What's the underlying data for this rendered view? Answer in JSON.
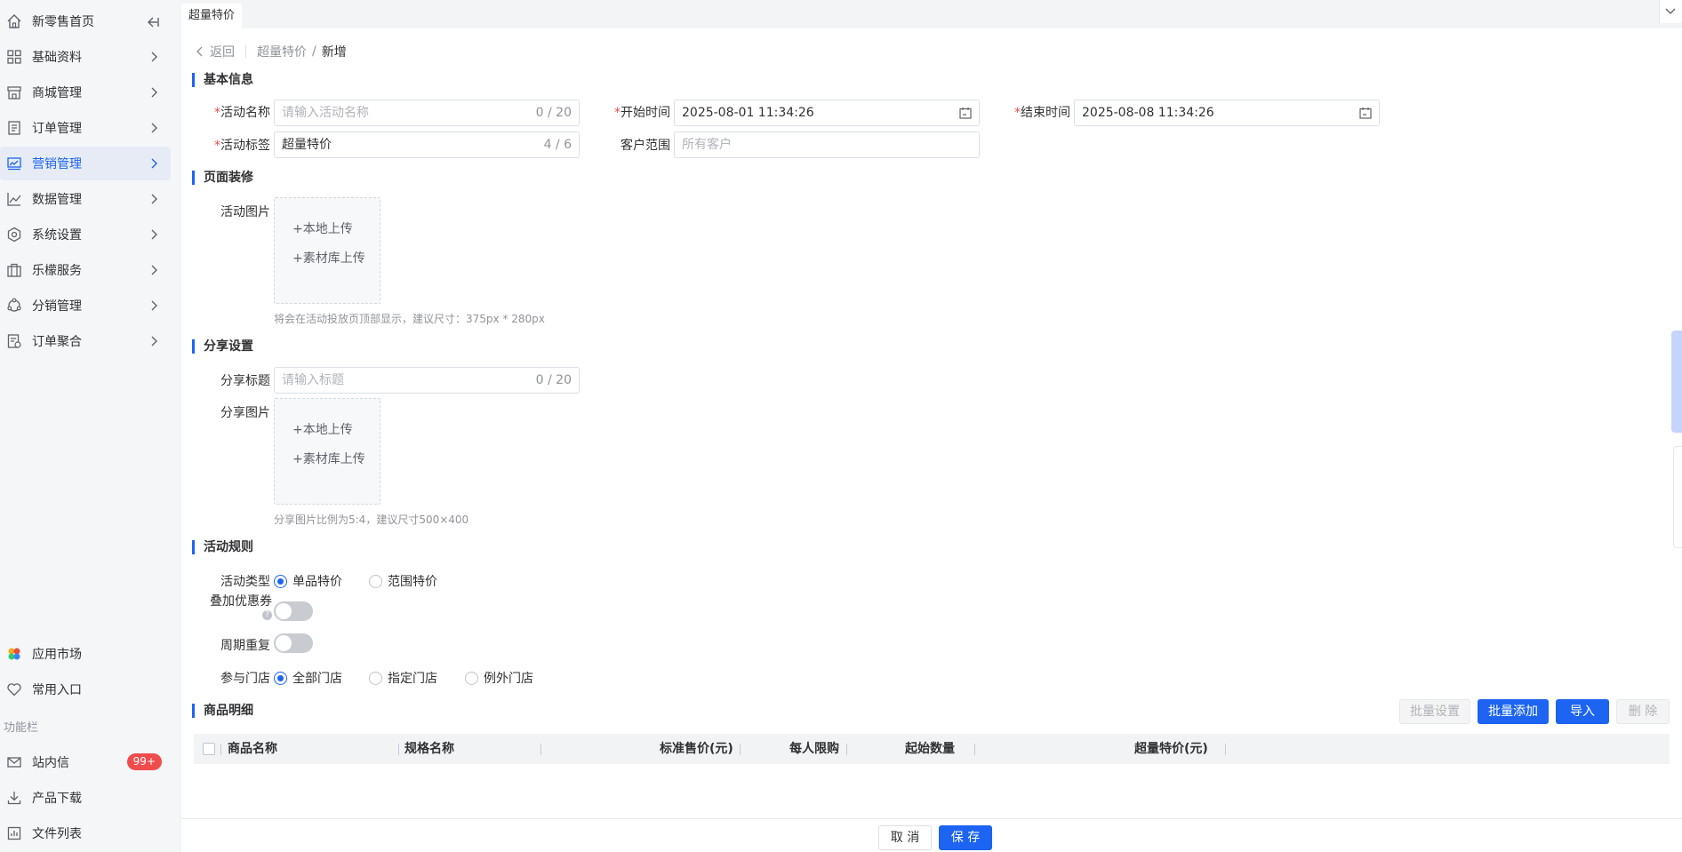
{
  "sidebar": {
    "items": [
      {
        "label": "新零售首页",
        "icon": "home-icon"
      },
      {
        "label": "基础资料",
        "icon": "grid-icon"
      },
      {
        "label": "商城管理",
        "icon": "store-icon"
      },
      {
        "label": "订单管理",
        "icon": "order-icon"
      },
      {
        "label": "营销管理",
        "icon": "marketing-icon"
      },
      {
        "label": "数据管理",
        "icon": "chart-icon"
      },
      {
        "label": "系统设置",
        "icon": "settings-icon"
      },
      {
        "label": "乐檬服务",
        "icon": "service-icon"
      },
      {
        "label": "分销管理",
        "icon": "distribution-icon"
      },
      {
        "label": "订单聚合",
        "icon": "aggregate-icon"
      }
    ],
    "bottom": [
      {
        "label": "应用市场",
        "icon": "app-market-icon"
      },
      {
        "label": "常用入口",
        "icon": "heart-icon"
      }
    ],
    "section_label": "功能栏",
    "tools": [
      {
        "label": "站内信",
        "icon": "mail-icon",
        "badge": "99+"
      },
      {
        "label": "产品下载",
        "icon": "download-icon"
      },
      {
        "label": "文件列表",
        "icon": "file-list-icon"
      }
    ]
  },
  "tabs": {
    "active": "超量特价"
  },
  "breadcrumb": {
    "back": "返回",
    "parent": "超量特价",
    "separator": "/",
    "current": "新增"
  },
  "basic": {
    "title": "基本信息",
    "name_label": "活动名称",
    "name_placeholder": "请输入活动名称",
    "name_count": "0 / 20",
    "start_label": "开始时间",
    "start_value": "2025-08-01 11:34:26",
    "end_label": "结束时间",
    "end_value": "2025-08-08 11:34:26",
    "tag_label": "活动标签",
    "tag_value": "超量特价",
    "tag_count": "4 / 6",
    "customer_label": "客户范围",
    "customer_placeholder": "所有客户"
  },
  "decor": {
    "title": "页面装修",
    "image_label": "活动图片",
    "local_upload": "+本地上传",
    "library_upload": "+素材库上传",
    "hint": "将会在活动投放页顶部显示，建议尺寸：375px * 280px"
  },
  "share": {
    "title": "分享设置",
    "title_label": "分享标题",
    "title_placeholder": "请输入标题",
    "title_count": "0 / 20",
    "image_label": "分享图片",
    "local_upload": "+本地上传",
    "library_upload": "+素材库上传",
    "hint": "分享图片比例为5:4，建议尺寸500×400"
  },
  "rules": {
    "title": "活动规则",
    "type_label": "活动类型",
    "type_options": [
      "单品特价",
      "范围特价"
    ],
    "type_selected": 0,
    "stack_label": "叠加优惠券",
    "stack_on": false,
    "repeat_label": "周期重复",
    "repeat_on": false,
    "store_label": "参与门店",
    "store_options": [
      "全部门店",
      "指定门店",
      "例外门店"
    ],
    "store_selected": 0
  },
  "goods": {
    "title": "商品明细",
    "buttons": {
      "batch_set": "批量设置",
      "batch_add": "批量添加",
      "import": "导入",
      "delete": "删 除"
    },
    "columns": [
      "商品名称",
      "规格名称",
      "标准售价(元)",
      "每人限购",
      "起始数量",
      "超量特价(元)"
    ]
  },
  "footer": {
    "cancel": "取 消",
    "save": "保 存"
  },
  "colors": {
    "primary": "#1d64f2",
    "required": "#f04c4c"
  }
}
